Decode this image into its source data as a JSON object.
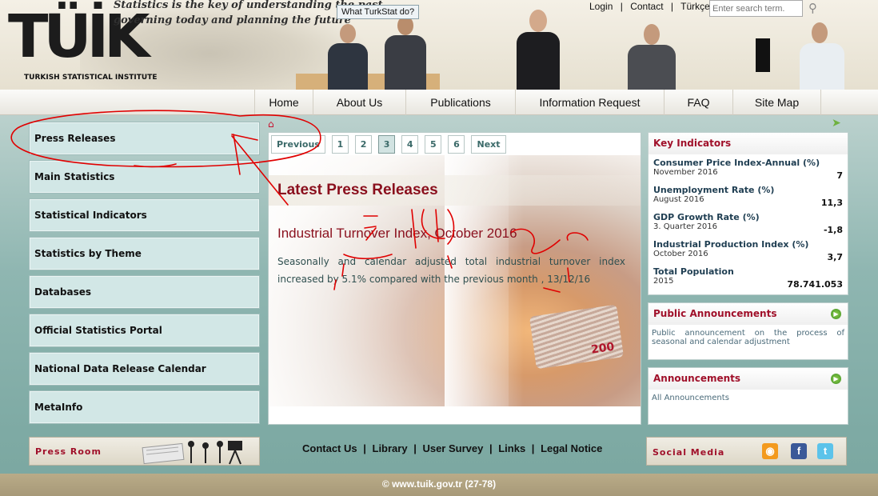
{
  "logo": {
    "text": "TÜİK",
    "subtitle": "TURKISH STATISTICAL INSTITUTE"
  },
  "slogan": [
    "Statistics is the key of understanding the past,",
    "governing today and planning the future"
  ],
  "bubble": "What TurkStat do?",
  "top_nav": {
    "login": "Login",
    "sep": "|",
    "contact": "Contact",
    "lang": "Türkçe"
  },
  "search": {
    "placeholder": "Enter search term."
  },
  "main_nav": [
    "Home",
    "About Us",
    "Publications",
    "Information Request",
    "FAQ",
    "Site Map"
  ],
  "sidebar": [
    "Press Releases",
    "Main Statistics",
    "Statistical Indicators",
    "Statistics by Theme",
    "Databases",
    "Official Statistics Portal",
    "National Data Release Calendar",
    "MetaInfo"
  ],
  "press_room": "Press Room",
  "pager": {
    "prev": "Previous",
    "pages": [
      "1",
      "2",
      "3",
      "4",
      "5",
      "6"
    ],
    "next": "Next",
    "active": "3"
  },
  "latest": {
    "heading": "Latest Press Releases",
    "title": "Industrial Turnover Index, October 2016",
    "body": "Seasonally and calendar adjusted total industrial turnover index increased by 5.1% compared with the previous month , 13/12/16",
    "banknote": "200"
  },
  "key_indicators": {
    "title": "Key Indicators",
    "items": [
      {
        "name": "Consumer Price Index-Annual (%)",
        "period": "November 2016",
        "value": "7"
      },
      {
        "name": "Unemployment Rate (%)",
        "period": "August 2016",
        "value": "11,3"
      },
      {
        "name": "GDP Growth Rate (%)",
        "period": "3. Quarter 2016",
        "value": "-1,8"
      },
      {
        "name": "Industrial Production Index (%)",
        "period": "October 2016",
        "value": "3,7"
      },
      {
        "name": "Total Population",
        "period": "2015",
        "value": "78.741.053"
      }
    ]
  },
  "public_announcements": {
    "title": "Public Announcements",
    "text": "Public announcement on the process of seasonal and calendar adjustment"
  },
  "announcements": {
    "title": "Announcements",
    "text": "All Announcements"
  },
  "footer_links": [
    "Contact Us",
    "Library",
    "User Survey",
    "Links",
    "Legal Notice"
  ],
  "social": {
    "label": "Social Media"
  },
  "copyright": "© www.tuik.gov.tr (27-78)",
  "colors": {
    "brand_red": "#c8102e",
    "heading_red": "#8a0f1d",
    "sidebar_bg": "#d2e7e6",
    "annotation": "#e00000"
  }
}
